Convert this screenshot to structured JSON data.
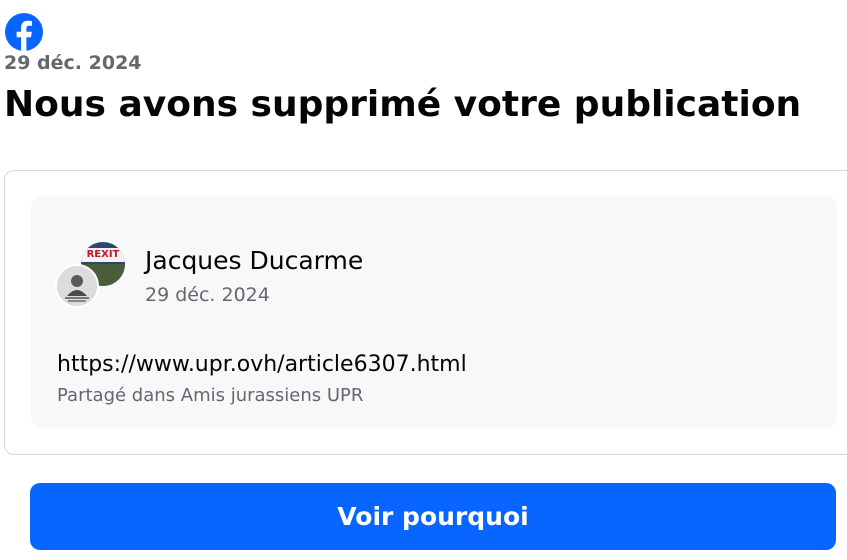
{
  "header": {
    "logo_icon": "facebook-icon",
    "date": "29 déc. 2024",
    "title": "Nous avons supprimé votre publication"
  },
  "post": {
    "author": "Jacques Ducarme",
    "date": "29 déc. 2024",
    "link": "https://www.upr.ovh/article6307.html",
    "shared_in": "Partagé dans Amis jurassiens UPR",
    "group_avatar_text": "REXIT"
  },
  "cta": {
    "label": "Voir pourquoi"
  },
  "colors": {
    "brand": "#0866ff",
    "secondary_text": "#65676b",
    "card_background": "#f7f8fa"
  }
}
